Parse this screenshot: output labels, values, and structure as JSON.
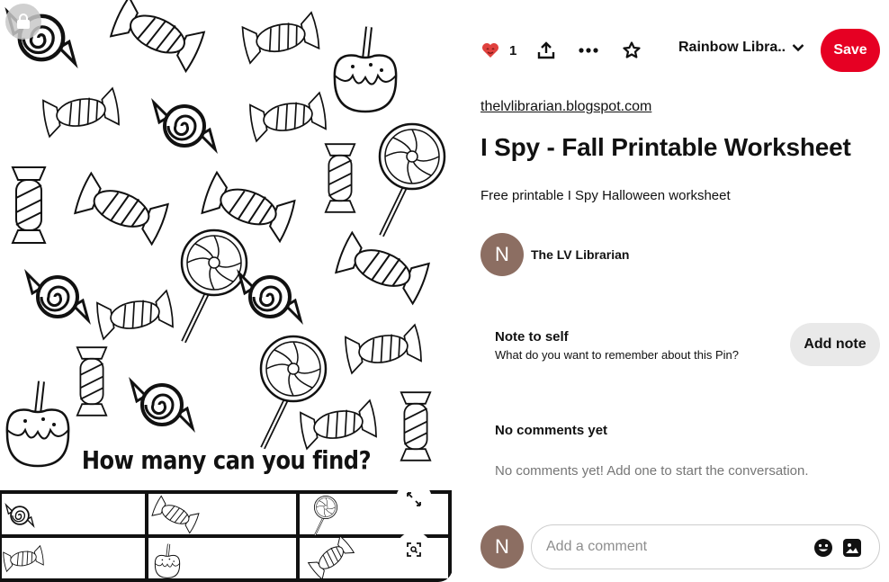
{
  "pin_image": {
    "caption": "How many can you find?"
  },
  "actions": {
    "like_count": "1",
    "board_name": "Rainbow Libra...",
    "save_label": "Save"
  },
  "pin": {
    "source": "thelvlibrarian.blogspot.com",
    "title": "I Spy - Fall Printable Worksheet",
    "description": "Free printable I Spy Halloween worksheet"
  },
  "creator": {
    "initial": "N",
    "name": "The LV Librarian"
  },
  "note": {
    "title": "Note to self",
    "subtitle": "What do you want to remember about this Pin?",
    "button_label": "Add note"
  },
  "comments": {
    "heading": "No comments yet",
    "empty_text": "No comments yet! Add one to start the conversation.",
    "avatar_initial": "N",
    "placeholder": "Add a comment"
  },
  "colors": {
    "brand_red": "#e60023",
    "avatar_brown": "#8c6e62",
    "button_gray": "#e9e9e9"
  },
  "icons": [
    "lock-icon",
    "heart-icon",
    "share-icon",
    "more-icon",
    "star-icon",
    "chevron-down-icon",
    "expand-icon",
    "visual-search-icon",
    "emoji-icon",
    "image-upload-icon"
  ]
}
